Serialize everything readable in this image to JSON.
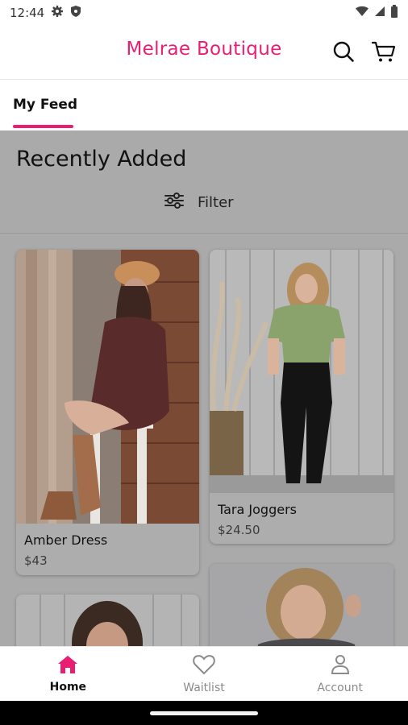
{
  "status_bar": {
    "time": "12:44"
  },
  "app_bar": {
    "title": "Melrae Boutique"
  },
  "tabs": [
    {
      "label": "My Feed",
      "selected": true
    }
  ],
  "section": {
    "title": "Recently Added",
    "filter_label": "Filter"
  },
  "products": [
    {
      "name": "Amber Dress",
      "price": "$43"
    },
    {
      "name": "Tara Joggers",
      "price": "$24.50"
    }
  ],
  "bottom_nav": {
    "items": [
      {
        "label": "Home",
        "icon": "home-icon",
        "active": true
      },
      {
        "label": "Waitlist",
        "icon": "heart-icon",
        "active": false
      },
      {
        "label": "Account",
        "icon": "person-icon",
        "active": false
      }
    ]
  },
  "colors": {
    "accent": "#e91e72",
    "overlay": "#aaaaaa"
  }
}
